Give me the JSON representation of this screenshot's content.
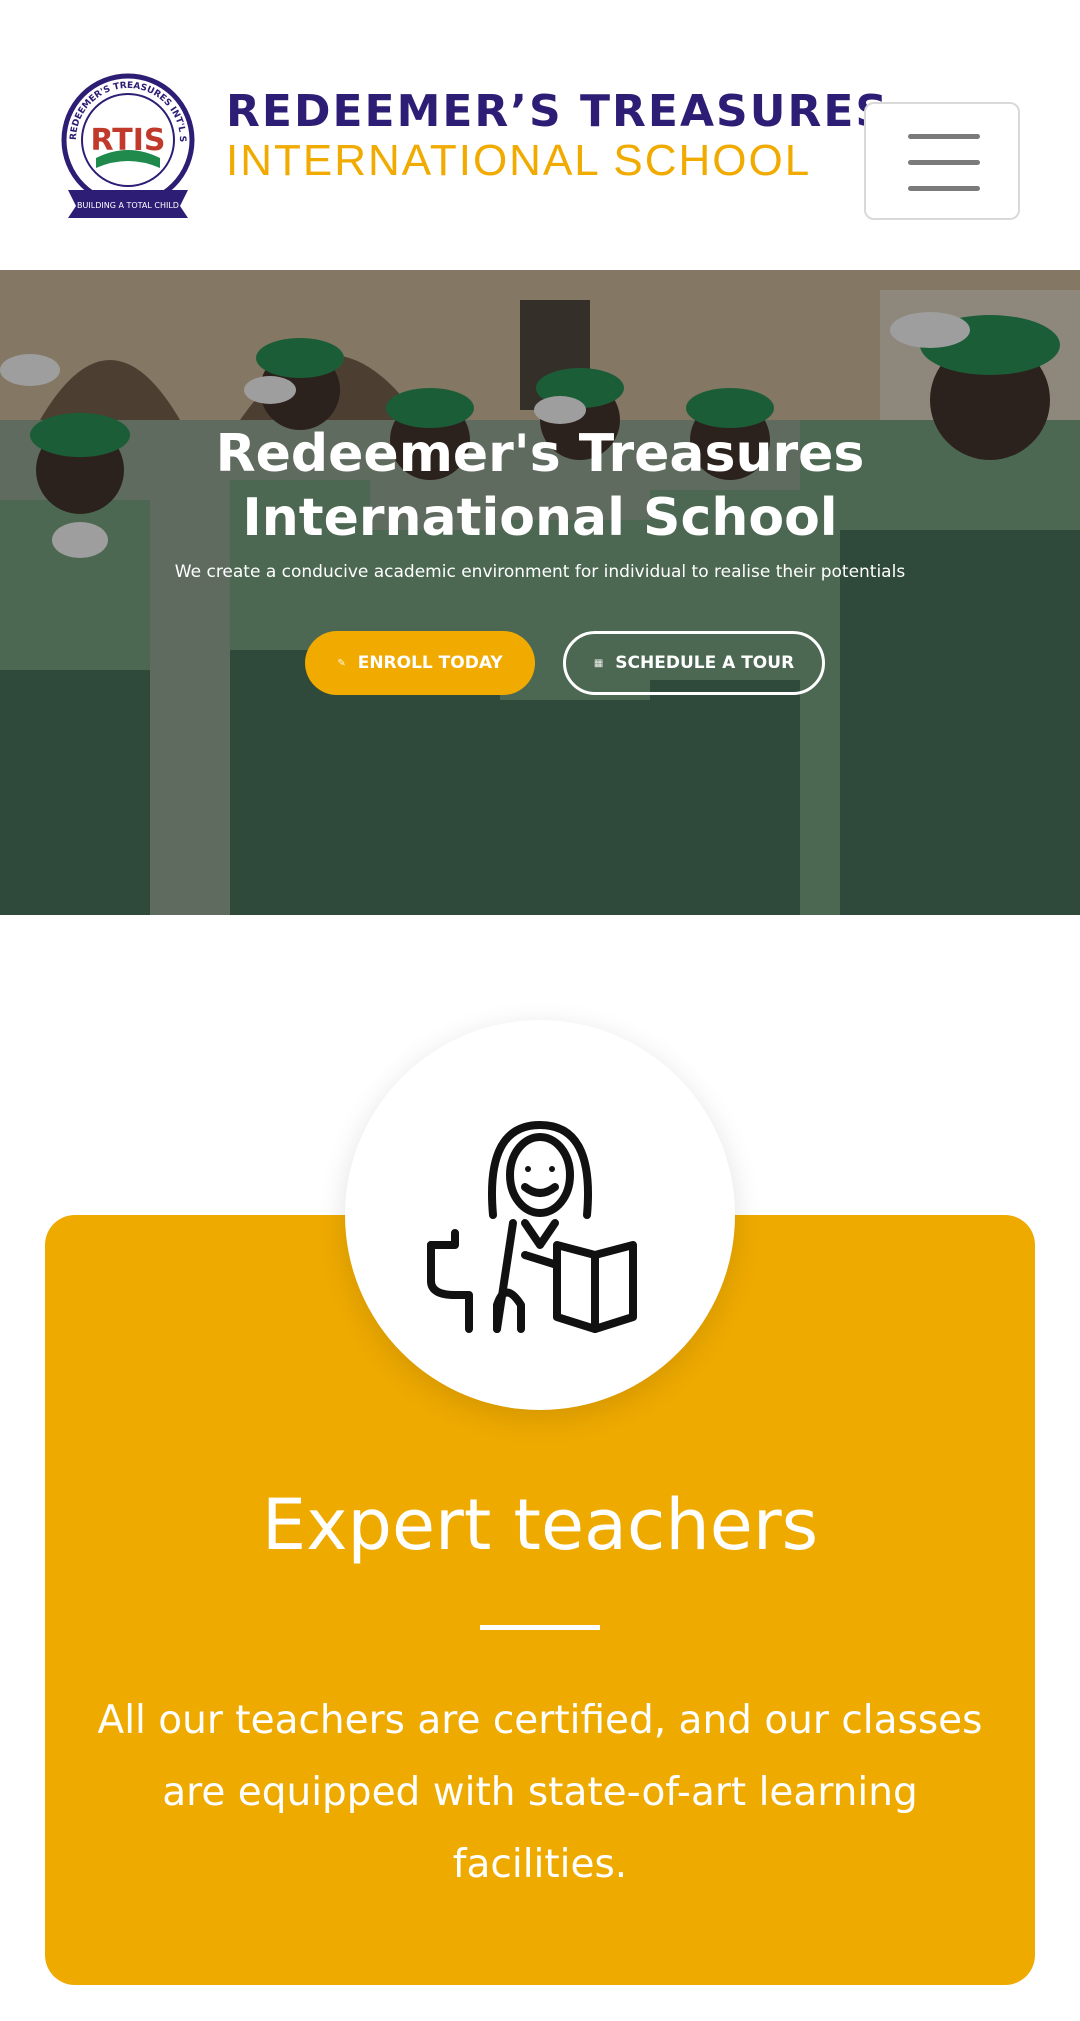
{
  "header": {
    "brand_line1": "REDEEMER’S TREASURES",
    "brand_line2": "INTERNATIONAL  SCHOOL",
    "logo": {
      "initials": "RTIS",
      "ring_text": "REDEEMER'S TREASURES INT'L SCHOOLS",
      "motto": "BUILDING A TOTAL CHILD"
    },
    "menu_icon": "hamburger-menu-icon"
  },
  "hero": {
    "title_line1": "Redeemer's Treasures",
    "title_line2": "International School",
    "subtitle": "We create a conducive academic environment for individual to realise their potentials",
    "enroll_button": "ENROLL TODAY",
    "tour_button": "SCHEDULE A TOUR",
    "enroll_icon": "pencil-icon",
    "tour_icon": "calendar-icon"
  },
  "feature": {
    "icon": "teacher-with-book-icon",
    "title": "Expert teachers",
    "text": "All our teachers are certified, and our classes are equipped with state-of-art learning facilities."
  },
  "colors": {
    "brand_purple": "#2e1d74",
    "brand_gold": "#f1ab00",
    "accent": "#efaa00",
    "uniform_green": "#1f8a4c"
  }
}
